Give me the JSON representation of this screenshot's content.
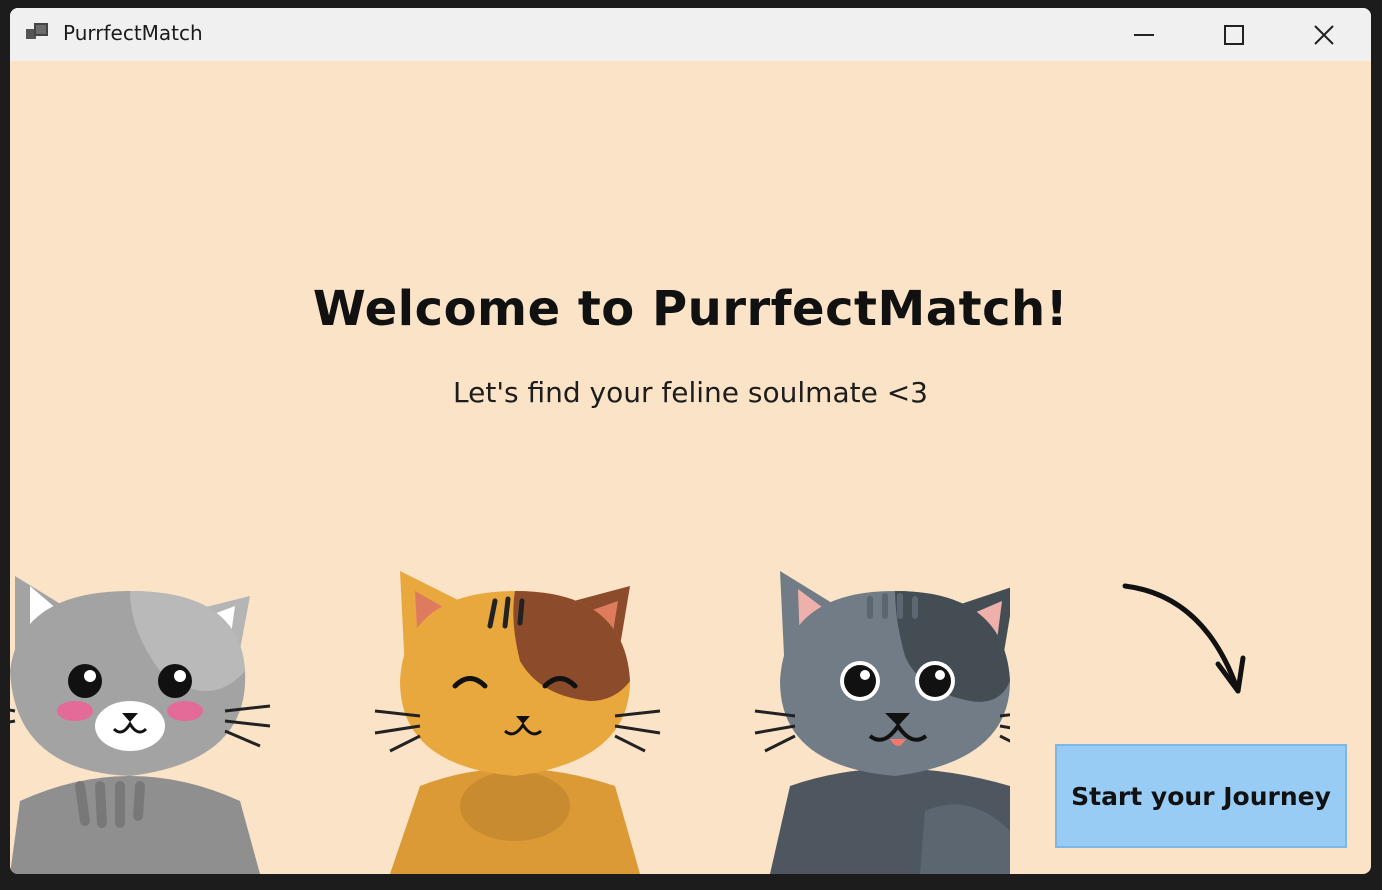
{
  "window": {
    "title": "PurrfectMatch",
    "controls": [
      "minimize",
      "maximize",
      "close"
    ]
  },
  "main": {
    "headline": "Welcome to PurrfectMatch!",
    "subtitle": "Let's find your feline soulmate <3",
    "start_button_label": "Start your Journey"
  },
  "illustration": {
    "cats": [
      "gray-cat",
      "orange-calico-cat",
      "dark-gray-cat"
    ],
    "arrow": "curved-arrow-pointing-down"
  },
  "colors": {
    "background": "#fae3c6",
    "button": "#99ccf5",
    "titlebar": "#f0f0f0"
  }
}
